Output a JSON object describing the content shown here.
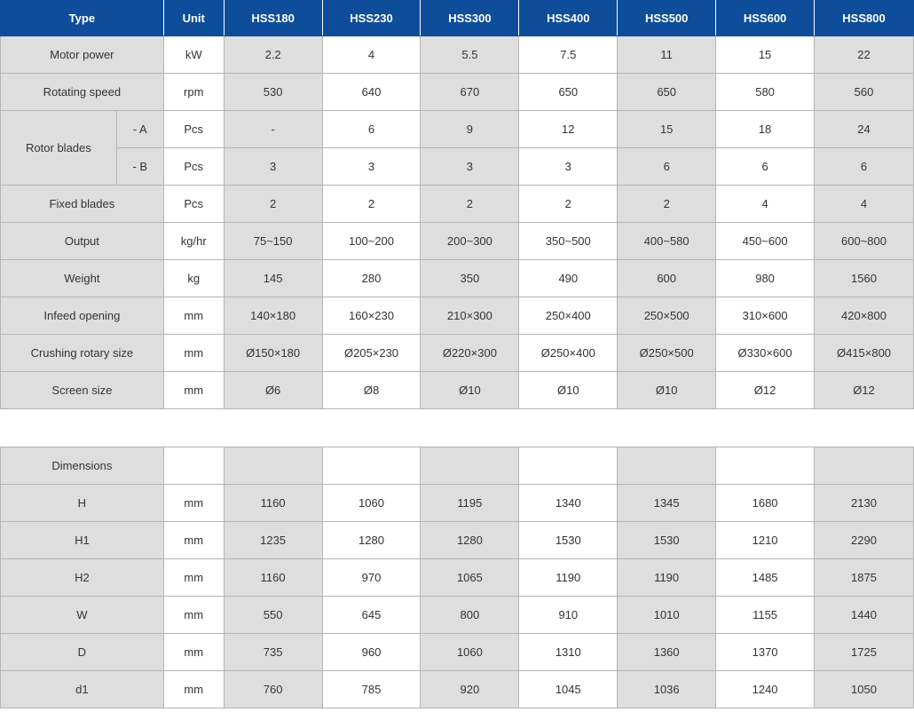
{
  "header": {
    "type": "Type",
    "unit": "Unit",
    "models": [
      "HSS180",
      "HSS230",
      "HSS300",
      "HSS400",
      "HSS500",
      "HSS600",
      "HSS800"
    ]
  },
  "specs": {
    "motor_power": {
      "label": "Motor power",
      "unit": "kW",
      "values": [
        "2.2",
        "4",
        "5.5",
        "7.5",
        "11",
        "15",
        "22"
      ]
    },
    "rotating_speed": {
      "label": "Rotating speed",
      "unit": "rpm",
      "values": [
        "530",
        "640",
        "670",
        "650",
        "650",
        "580",
        "560"
      ]
    },
    "rotor_blades": {
      "label": "Rotor blades",
      "a": {
        "sublabel": "- A",
        "unit": "Pcs",
        "values": [
          "-",
          "6",
          "9",
          "12",
          "15",
          "18",
          "24"
        ]
      },
      "b": {
        "sublabel": "- B",
        "unit": "Pcs",
        "values": [
          "3",
          "3",
          "3",
          "3",
          "6",
          "6",
          "6"
        ]
      }
    },
    "fixed_blades": {
      "label": "Fixed blades",
      "unit": "Pcs",
      "values": [
        "2",
        "2",
        "2",
        "2",
        "2",
        "4",
        "4"
      ]
    },
    "output": {
      "label": "Output",
      "unit": "kg/hr",
      "values": [
        "75~150",
        "100~200",
        "200~300",
        "350~500",
        "400~580",
        "450~600",
        "600~800"
      ]
    },
    "weight": {
      "label": "Weight",
      "unit": "kg",
      "values": [
        "145",
        "280",
        "350",
        "490",
        "600",
        "980",
        "1560"
      ]
    },
    "infeed_opening": {
      "label": "Infeed opening",
      "unit": "mm",
      "values": [
        "140×180",
        "160×230",
        "210×300",
        "250×400",
        "250×500",
        "310×600",
        "420×800"
      ]
    },
    "crushing_rotary_size": {
      "label": "Crushing rotary size",
      "unit": "mm",
      "values": [
        "Ø150×180",
        "Ø205×230",
        "Ø220×300",
        "Ø250×400",
        "Ø250×500",
        "Ø330×600",
        "Ø415×800"
      ]
    },
    "screen_size": {
      "label": "Screen size",
      "unit": "mm",
      "values": [
        "Ø6",
        "Ø8",
        "Ø10",
        "Ø10",
        "Ø10",
        "Ø12",
        "Ø12"
      ]
    }
  },
  "dimensions": {
    "label": "Dimensions",
    "rows": [
      {
        "label": "H",
        "unit": "mm",
        "values": [
          "1160",
          "1060",
          "1195",
          "1340",
          "1345",
          "1680",
          "2130"
        ]
      },
      {
        "label": "H1",
        "unit": "mm",
        "values": [
          "1235",
          "1280",
          "1280",
          "1530",
          "1530",
          "1210",
          "2290"
        ]
      },
      {
        "label": "H2",
        "unit": "mm",
        "values": [
          "1160",
          "970",
          "1065",
          "1190",
          "1190",
          "1485",
          "1875"
        ]
      },
      {
        "label": "W",
        "unit": "mm",
        "values": [
          "550",
          "645",
          "800",
          "910",
          "1010",
          "1155",
          "1440"
        ]
      },
      {
        "label": "D",
        "unit": "mm",
        "values": [
          "735",
          "960",
          "1060",
          "1310",
          "1360",
          "1370",
          "1725"
        ]
      },
      {
        "label": "d1",
        "unit": "mm",
        "values": [
          "760",
          "785",
          "920",
          "1045",
          "1036",
          "1240",
          "1050"
        ]
      }
    ]
  }
}
